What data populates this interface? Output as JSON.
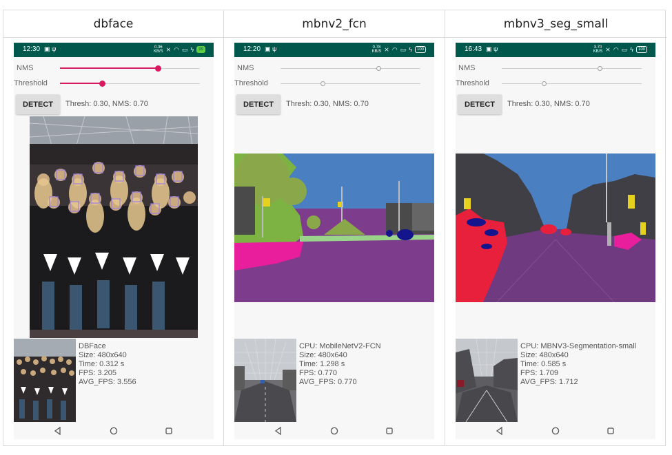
{
  "columns": [
    {
      "header": "dbface",
      "status_time": "12:30",
      "net_speed": [
        "0.36",
        "KB/S"
      ],
      "battery": "99",
      "nms_label": "NMS",
      "threshold_label": "Threshold",
      "nms_value": 0.7,
      "threshold_value": 0.3,
      "slider_style": "active",
      "detect_label": "DETECT",
      "thresh_text": "Thresh: 0.30, NMS: 0.70",
      "info": [
        "DBFace",
        "Size: 480x640",
        "Time: 0.312 s",
        "FPS: 3.205",
        "AVG_FPS: 3.556"
      ]
    },
    {
      "header": "mbnv2_fcn",
      "status_time": "12:20",
      "net_speed": [
        "0.78",
        "KB/S"
      ],
      "battery": "100",
      "nms_label": "NMS",
      "threshold_label": "Threshold",
      "nms_value": 0.7,
      "threshold_value": 0.3,
      "slider_style": "disabled",
      "detect_label": "DETECT",
      "thresh_text": "Thresh: 0.30, NMS: 0.70",
      "info": [
        "CPU: MobileNetV2-FCN",
        "Size: 480x640",
        "Time: 1.298 s",
        "FPS: 0.770",
        "AVG_FPS: 0.770"
      ]
    },
    {
      "header": "mbnv3_seg_small",
      "status_time": "16:43",
      "net_speed": [
        "3.70",
        "KB/S"
      ],
      "battery": "100",
      "nms_label": "NMS",
      "threshold_label": "Threshold",
      "nms_value": 0.7,
      "threshold_value": 0.3,
      "slider_style": "disabled",
      "detect_label": "DETECT",
      "thresh_text": "Thresh: 0.30, NMS: 0.70",
      "info": [
        "CPU: MBNV3-Segmentation-small",
        "Size: 480x640",
        "Time: 0.585 s",
        "FPS: 1.709",
        "AVG_FPS: 1.712"
      ]
    }
  ],
  "colors": {
    "status_bar": "#00574b",
    "accent": "#d81b60",
    "seg_sky": "#4a7fc1",
    "seg_road": "#7d3c8c",
    "seg_vegetation": "#7cb342",
    "seg_sidewalk": "#e91e9d",
    "seg_person": "#e8203c"
  }
}
